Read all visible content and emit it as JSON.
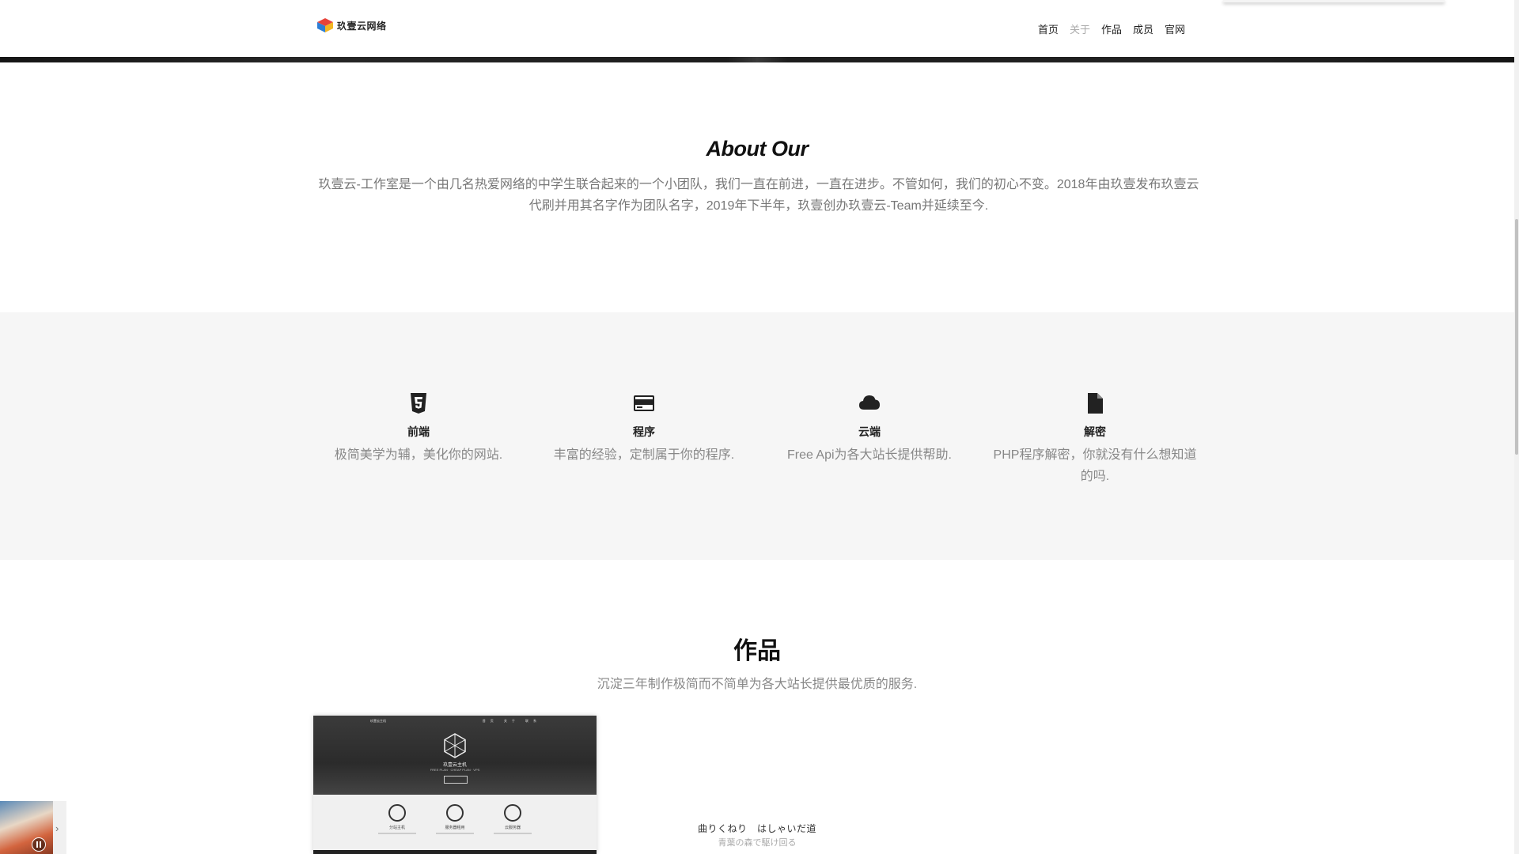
{
  "header": {
    "logo_text": "玖壹云网络",
    "nav": [
      {
        "label": "首页",
        "active": false
      },
      {
        "label": "关于",
        "active": true
      },
      {
        "label": "作品",
        "active": false
      },
      {
        "label": "成员",
        "active": false
      },
      {
        "label": "官网",
        "active": false
      }
    ]
  },
  "about": {
    "title": "About Our",
    "text": "玖壹云-工作室是一个由几名热爱网络的中学生联合起来的一个小团队，我们一直在前进，一直在进步。不管如何，我们的初心不变。2018年由玖壹发布玖壹云代刷并用其名字作为团队名字，2019年下半年，玖壹创办玖壹云-Team并延续至今."
  },
  "services": [
    {
      "icon": "html5-icon",
      "title": "前端",
      "desc": "极简美学为辅，美化你的网站."
    },
    {
      "icon": "credit-card-icon",
      "title": "程序",
      "desc": "丰富的经验，定制属于你的程序."
    },
    {
      "icon": "cloud-icon",
      "title": "云端",
      "desc": "Free Api为各大站长提供帮助."
    },
    {
      "icon": "file-icon",
      "title": "解密",
      "desc": "PHP程序解密，你就没有什么想知道的吗."
    }
  ],
  "works": {
    "title": "作品",
    "subtitle": "沉淀三年制作极简而不简单为各大站长提供最优质的服务.",
    "card": {
      "mini_nav": "玖壹云主机",
      "mini_links": "首页 关于 联系",
      "mini_title": "玖壹云主机",
      "mini_subtitle": "FREE PLAN · CHEAP PLAN · VPS",
      "mini_button": "立即购买",
      "features": [
        "分站主机",
        "服务器租用",
        "云服务器"
      ]
    }
  },
  "player": {
    "lyric": "曲りくねり　はしゃいだ道",
    "lyric_translation": "青葉の森で駆け回る",
    "state": "playing"
  },
  "colors": {
    "page_bg": "#ffffff",
    "section_alt_bg": "#f6f6f6",
    "text_muted": "#888888",
    "nav_active": "#aaaaaa"
  }
}
